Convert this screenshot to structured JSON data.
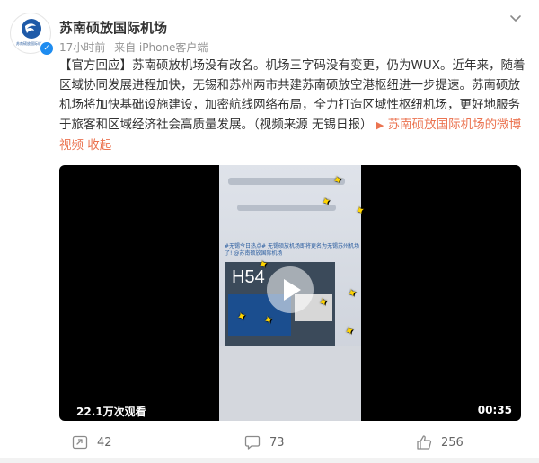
{
  "post": {
    "author": "苏南硕放国际机场",
    "avatar_text": "苏南硕放国际机场",
    "time": "17小时前",
    "source": "来自 iPhone客户端",
    "text_main": "【官方回应】苏南硕放机场没有改名。机场三字码没有变更，仍为WUX。近年来，随着区域协同发展进程加快，无锡和苏州两市共建苏南硕放空港枢纽进一步提速。苏南硕放机场将加快基础设施建设，加密航线网络布局，全力打造区域性枢纽机场，更好地服务于旅客和区域经济社会高质量发展。（视频来源 无锡日报）",
    "video_link": "苏南硕放国际机场的微博视频",
    "collect": "收起"
  },
  "video": {
    "views": "22.1万次观看",
    "duration": "00:35",
    "frame_hashtag": "#无锡今日热点# 无锡硕放机场即将更名为无锡苏州机场了! ",
    "frame_link": "@苏南硕放国际机场",
    "frame_h54": "H54"
  },
  "actions": {
    "repost": "42",
    "comment": "73",
    "like": "256"
  },
  "colors": {
    "link": "#eb7350",
    "verify": "#1e8cf0"
  }
}
